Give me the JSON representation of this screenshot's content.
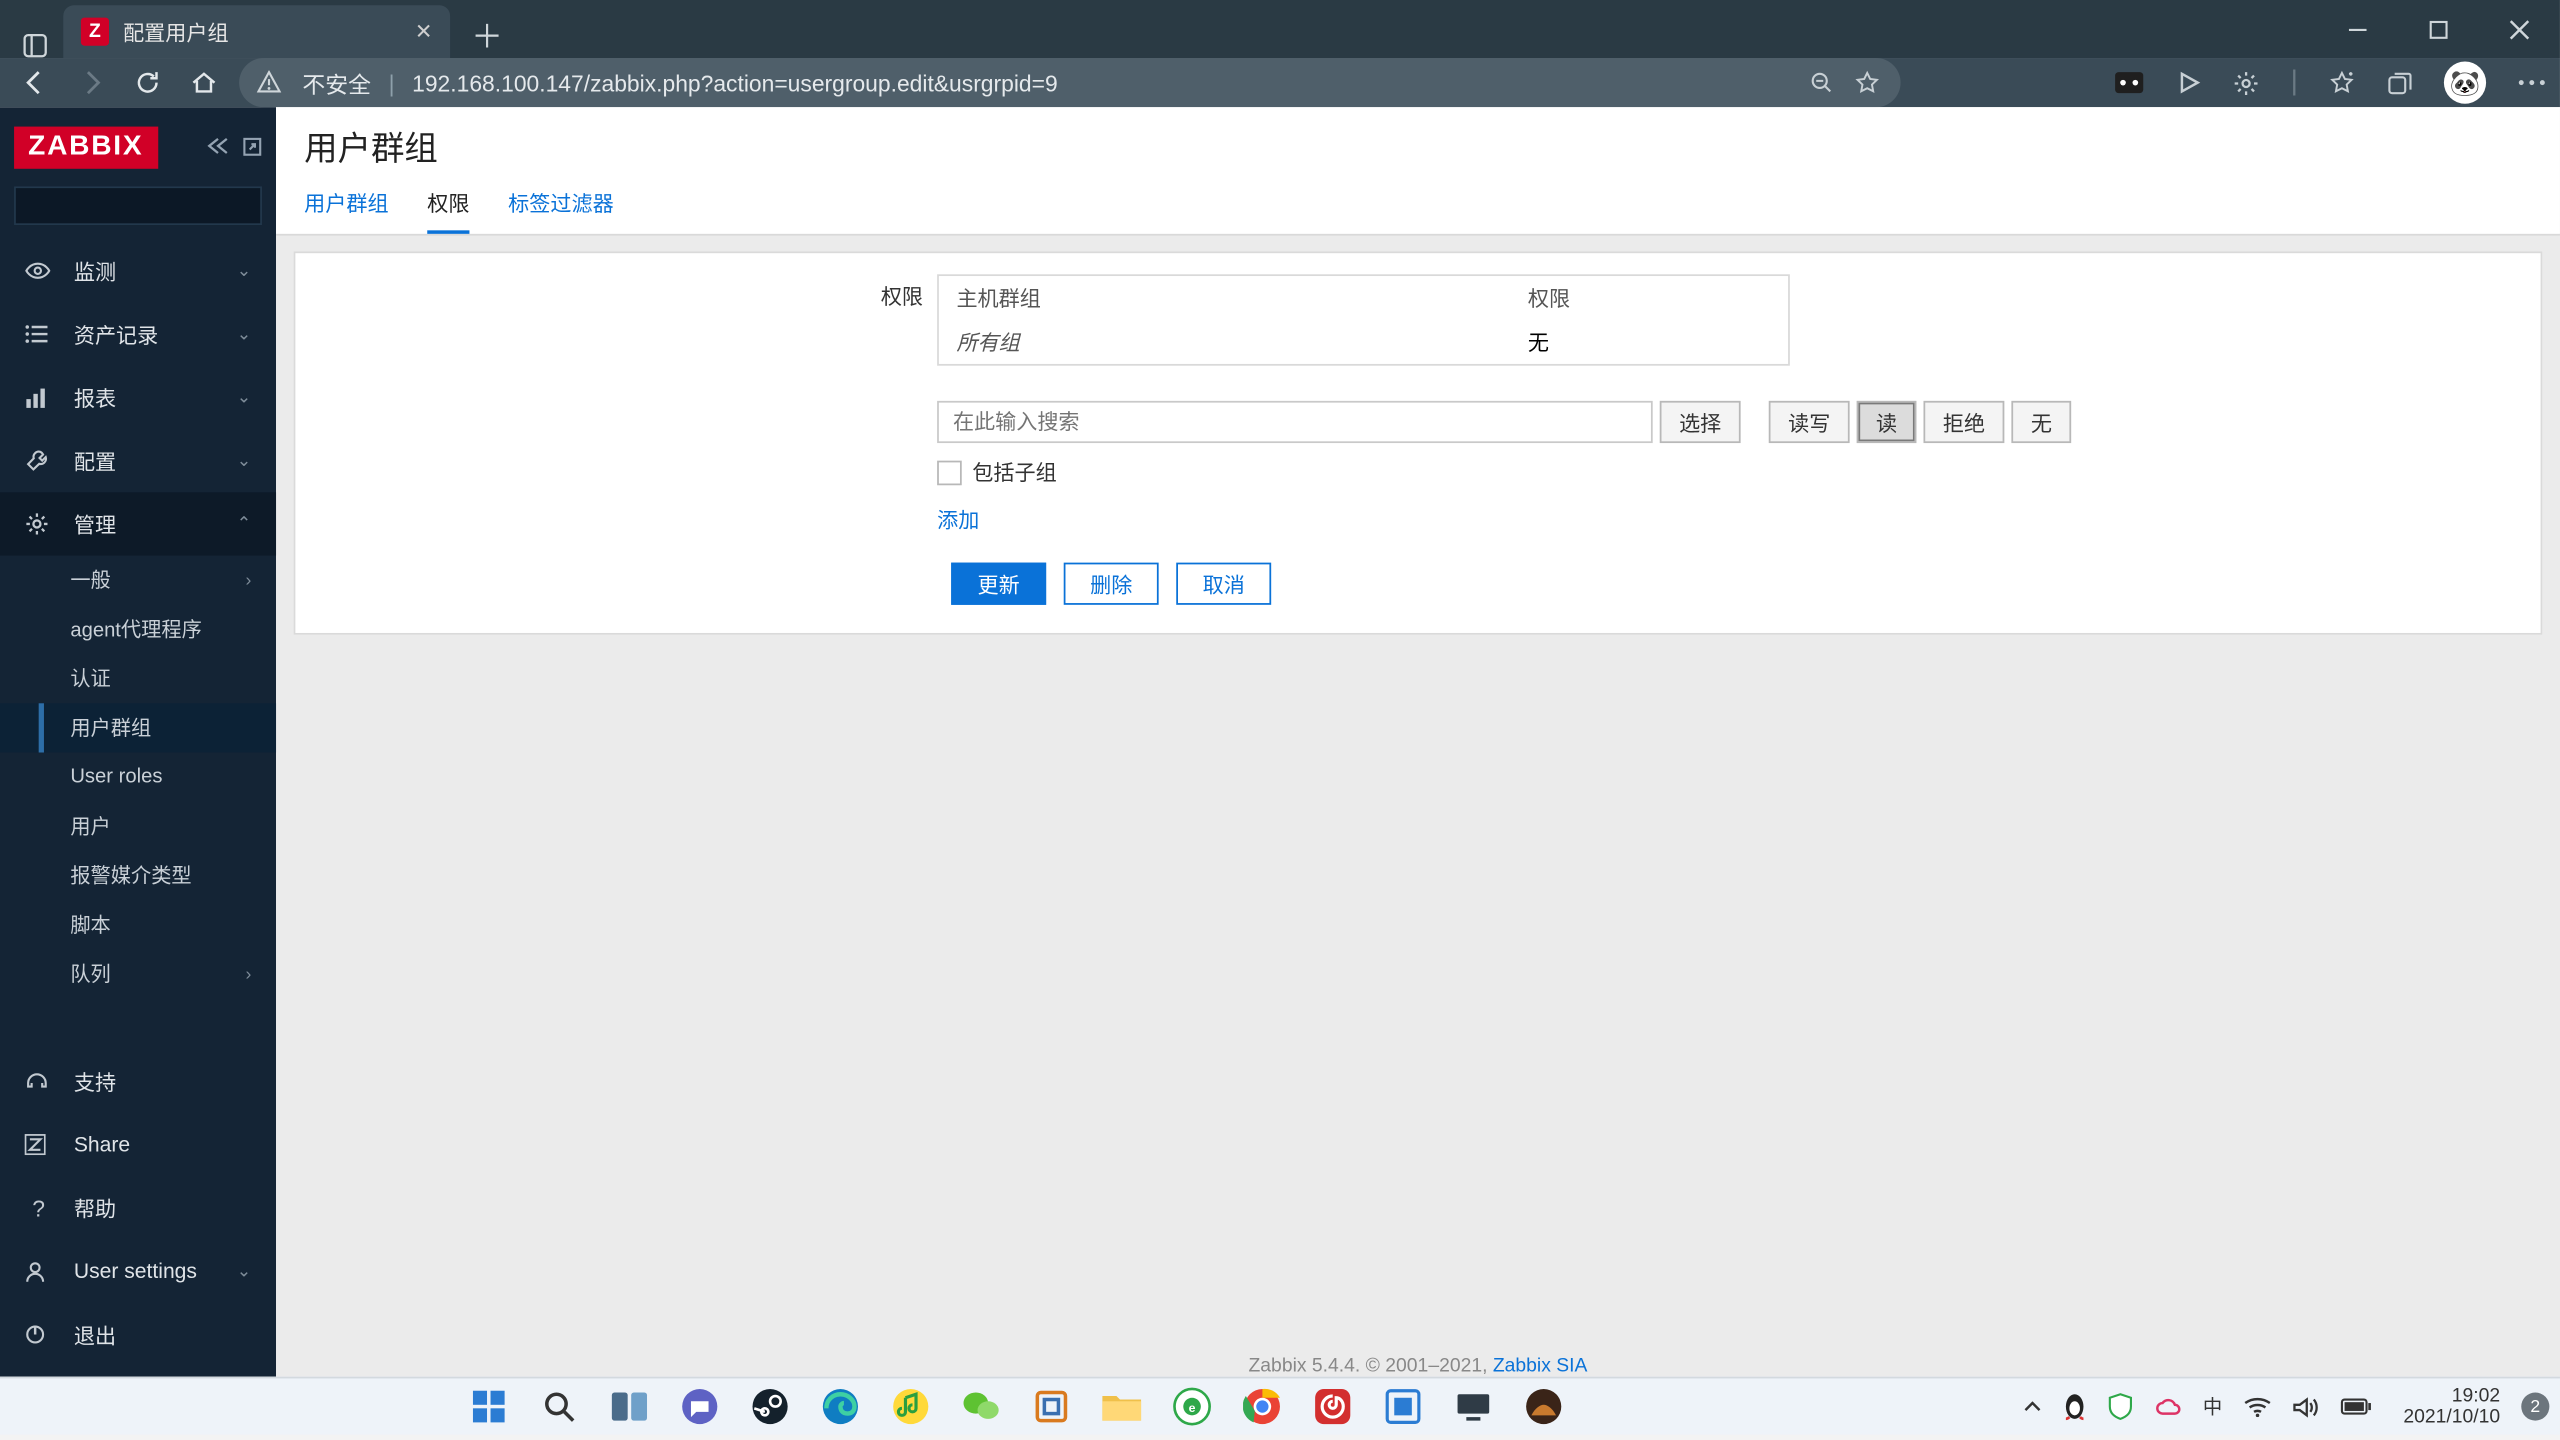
{
  "browser": {
    "tab_title": "配置用户组",
    "insecure_label": "不安全",
    "url": "192.168.100.147/zabbix.php?action=usergroup.edit&usrgrpid=9"
  },
  "sidebar": {
    "logo": "ZABBIX",
    "search_placeholder": "",
    "nav": [
      {
        "icon": "eye",
        "label": "监测"
      },
      {
        "icon": "list",
        "label": "资产记录"
      },
      {
        "icon": "chart",
        "label": "报表"
      },
      {
        "icon": "wrench",
        "label": "配置"
      },
      {
        "icon": "gear",
        "label": "管理",
        "open": true
      }
    ],
    "sub_admin": [
      {
        "label": "一般",
        "chev": true
      },
      {
        "label": "agent代理程序"
      },
      {
        "label": "认证"
      },
      {
        "label": "用户群组",
        "active": true
      },
      {
        "label": "User roles"
      },
      {
        "label": "用户"
      },
      {
        "label": "报警媒介类型"
      },
      {
        "label": "脚本"
      },
      {
        "label": "队列",
        "chev": true
      }
    ],
    "bottom": [
      {
        "icon": "headset",
        "label": "支持"
      },
      {
        "icon": "z",
        "label": "Share"
      },
      {
        "icon": "question",
        "label": "帮助"
      },
      {
        "icon": "user",
        "label": "User settings",
        "chev": true
      },
      {
        "icon": "power",
        "label": "退出"
      }
    ]
  },
  "page": {
    "title": "用户群组",
    "tabs": [
      "用户群组",
      "权限",
      "标签过滤器"
    ],
    "active_tab": 1,
    "perm": {
      "label": "权限",
      "col_hostgroup": "主机群组",
      "col_perm": "权限",
      "row_group": "所有组",
      "row_perm": "无",
      "search_placeholder": "在此输入搜索",
      "buttons": {
        "select": "选择",
        "rw": "读写",
        "r": "读",
        "deny": "拒绝",
        "none": "无"
      },
      "include_sub": "包括子组",
      "add": "添加"
    },
    "actions": {
      "update": "更新",
      "delete": "删除",
      "cancel": "取消"
    },
    "footer_text": "Zabbix 5.4.4. © 2001–2021, ",
    "footer_link": "Zabbix SIA"
  },
  "taskbar": {
    "tray_lang": "中",
    "time": "19:02",
    "date": "2021/10/10",
    "badge": "2"
  }
}
